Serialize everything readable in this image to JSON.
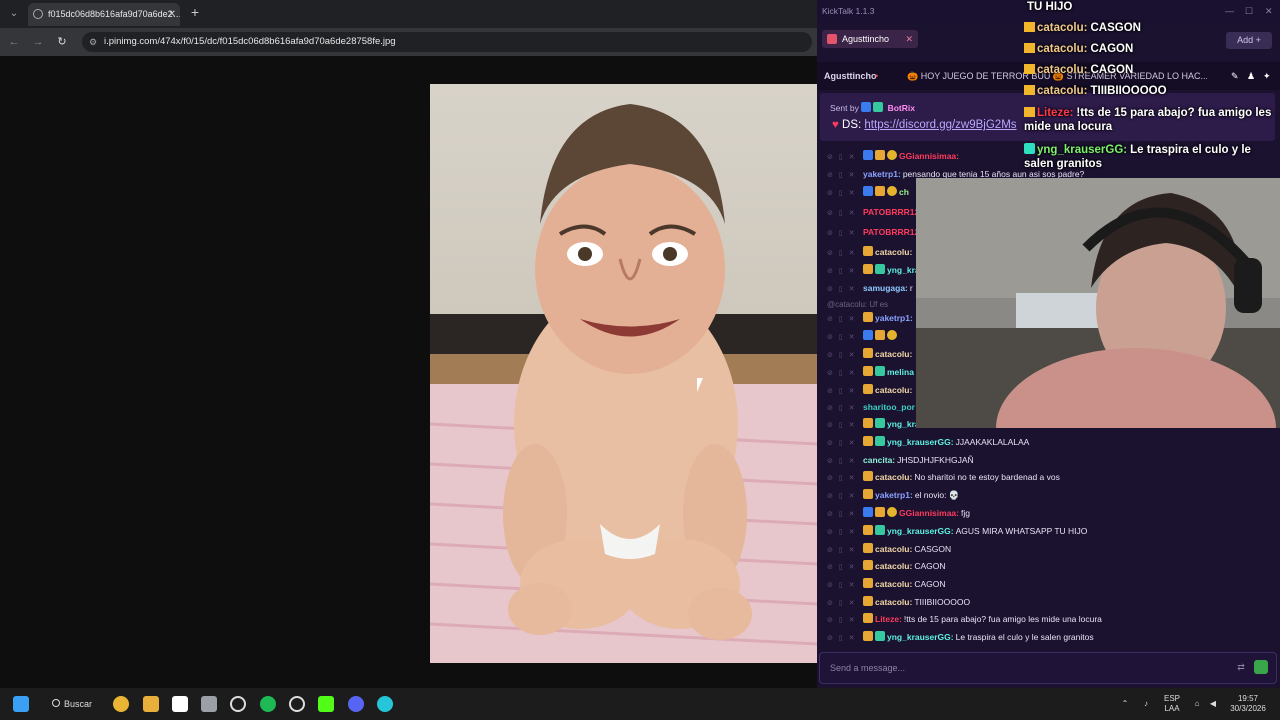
{
  "browser": {
    "tab_title": "f015dc06d8b616afa9d70a6de2…",
    "url": "i.pinimg.com/474x/f0/15/dc/f015dc06d8b616afa9d70a6de28758fe.jpg",
    "new_tab": "+",
    "close_tab": "✕"
  },
  "kicktalk": {
    "app_title": "KickTalk 1.1.3",
    "tab_label": "Agusttincho",
    "add_label": "Add",
    "channel_name": "Agusttincho",
    "stream_title": "🎃 HOY JUEGO DE TERROR BUU 🎃 STREAMER VARIEDAD LO HAC...",
    "pinned": {
      "sent_by": "Sent by",
      "bot_name": "BotRix",
      "ds_label": "DS:",
      "ds_link": "https://discord.gg/zw9BjG2Ms"
    },
    "reply_preview": "@catacolu: Uf es",
    "messages": [
      {
        "user": "GGiannisimaa:",
        "text": "",
        "cls": "u-r",
        "badges": [
          "blue",
          "crown",
          "gold"
        ]
      },
      {
        "user": "yaketrp1:",
        "text": "pensando que tenia 15 años aun asi sos padre?",
        "cls": "u-y",
        "badges": []
      },
      {
        "user": "ch",
        "text": "",
        "cls": "u-g",
        "badges": [
          "blue",
          "crown",
          "gold"
        ]
      },
      {
        "user": "PATOBRRR12",
        "text": "",
        "cls": "u-p",
        "badges": []
      },
      {
        "user": "PATOBRRR12",
        "text": "",
        "cls": "u-p",
        "badges": []
      },
      {
        "user": "catacolu:",
        "text": "",
        "cls": "u-c",
        "badges": [
          "crown"
        ]
      },
      {
        "user": "yng_kraus",
        "text": "",
        "cls": "u-k",
        "badges": [
          "crown",
          "green"
        ]
      },
      {
        "user": "samugaga:",
        "text": "r",
        "cls": "u-sa",
        "badges": []
      },
      {
        "user": "yaketrp1:",
        "text": "",
        "cls": "u-y",
        "badges": [
          "crown"
        ]
      },
      {
        "user": "",
        "text": "",
        "cls": "u-r",
        "badges": [
          "blue",
          "crown",
          "gold"
        ]
      },
      {
        "user": "catacolu:",
        "text": "",
        "cls": "u-c",
        "badges": [
          "crown"
        ]
      },
      {
        "user": "melina",
        "text": "",
        "cls": "u-k",
        "badges": [
          "crown",
          "green"
        ]
      },
      {
        "user": "catacolu:",
        "text": "",
        "cls": "u-c",
        "badges": [
          "crown"
        ]
      },
      {
        "user": "sharitoo_por",
        "text": "",
        "cls": "u-sh",
        "badges": []
      },
      {
        "user": "yng_kraus",
        "text": "",
        "cls": "u-k",
        "badges": [
          "crown",
          "green"
        ]
      },
      {
        "user": "yng_krauserGG:",
        "text": "JJAAKAKLALALAA",
        "cls": "u-k",
        "badges": [
          "crown",
          "green"
        ]
      },
      {
        "user": "cancita:",
        "text": "JHSDJHJFKHGJAÑ",
        "cls": "u-ca",
        "badges": []
      },
      {
        "user": "catacolu:",
        "text": "No sharitoi no te estoy bardenad a vos",
        "cls": "u-c",
        "badges": [
          "crown"
        ]
      },
      {
        "user": "yaketrp1:",
        "text": "el novio: 💀",
        "cls": "u-y",
        "badges": [
          "crown"
        ]
      },
      {
        "user": "GGiannisimaa:",
        "text": "fjg",
        "cls": "u-r",
        "badges": [
          "blue",
          "crown",
          "gold"
        ]
      },
      {
        "user": "yng_krauserGG:",
        "text": "AGUS MIRA WHATSAPP TU HIJO",
        "cls": "u-k",
        "badges": [
          "crown",
          "green"
        ]
      },
      {
        "user": "catacolu:",
        "text": "CASGON",
        "cls": "u-c",
        "badges": [
          "crown"
        ]
      },
      {
        "user": "catacolu:",
        "text": "CAGON",
        "cls": "u-c",
        "badges": [
          "crown"
        ]
      },
      {
        "user": "catacolu:",
        "text": "CAGON",
        "cls": "u-c",
        "badges": [
          "crown"
        ]
      },
      {
        "user": "catacolu:",
        "text": "TIIIBIIOOOOO",
        "cls": "u-c",
        "badges": [
          "crown"
        ]
      },
      {
        "user": "Liteze:",
        "text": "!tts de 15 para abajo? fua amigo les mide una locura",
        "cls": "u-r",
        "badges": [
          "crown"
        ]
      },
      {
        "user": "yng_krauserGG:",
        "text": "Le traspira el culo y le salen granitos",
        "cls": "u-k",
        "badges": [
          "crown",
          "green"
        ]
      }
    ],
    "send_placeholder": "Send a message..."
  },
  "overlay": {
    "lines": [
      {
        "name": "",
        "text": "TU HIJO",
        "cls": "",
        "badge": "none"
      },
      {
        "name": "catacolu:",
        "text": "CASGON",
        "cls": "n-c",
        "badge": "crown"
      },
      {
        "name": "catacolu:",
        "text": "CAGON",
        "cls": "n-c",
        "badge": "crown"
      },
      {
        "name": "catacolu:",
        "text": "CAGON",
        "cls": "n-c",
        "badge": "crown"
      },
      {
        "name": "catacolu:",
        "text": "TIIIBIIOOOOO",
        "cls": "n-c",
        "badge": "crown"
      },
      {
        "name": "Liteze:",
        "text": "!tts de 15 para abajo? fua amigo les mide una locura",
        "cls": "n-l",
        "badge": "crown"
      },
      {
        "name": "yng_krauserGG:",
        "text": "Le traspira el culo y le salen granitos",
        "cls": "n-y",
        "badge": "green"
      }
    ]
  },
  "taskbar": {
    "search_label": "Buscar",
    "lang_1": "ESP",
    "lang_2": "LAA",
    "time": "19:57",
    "date": "30/3/2026"
  }
}
